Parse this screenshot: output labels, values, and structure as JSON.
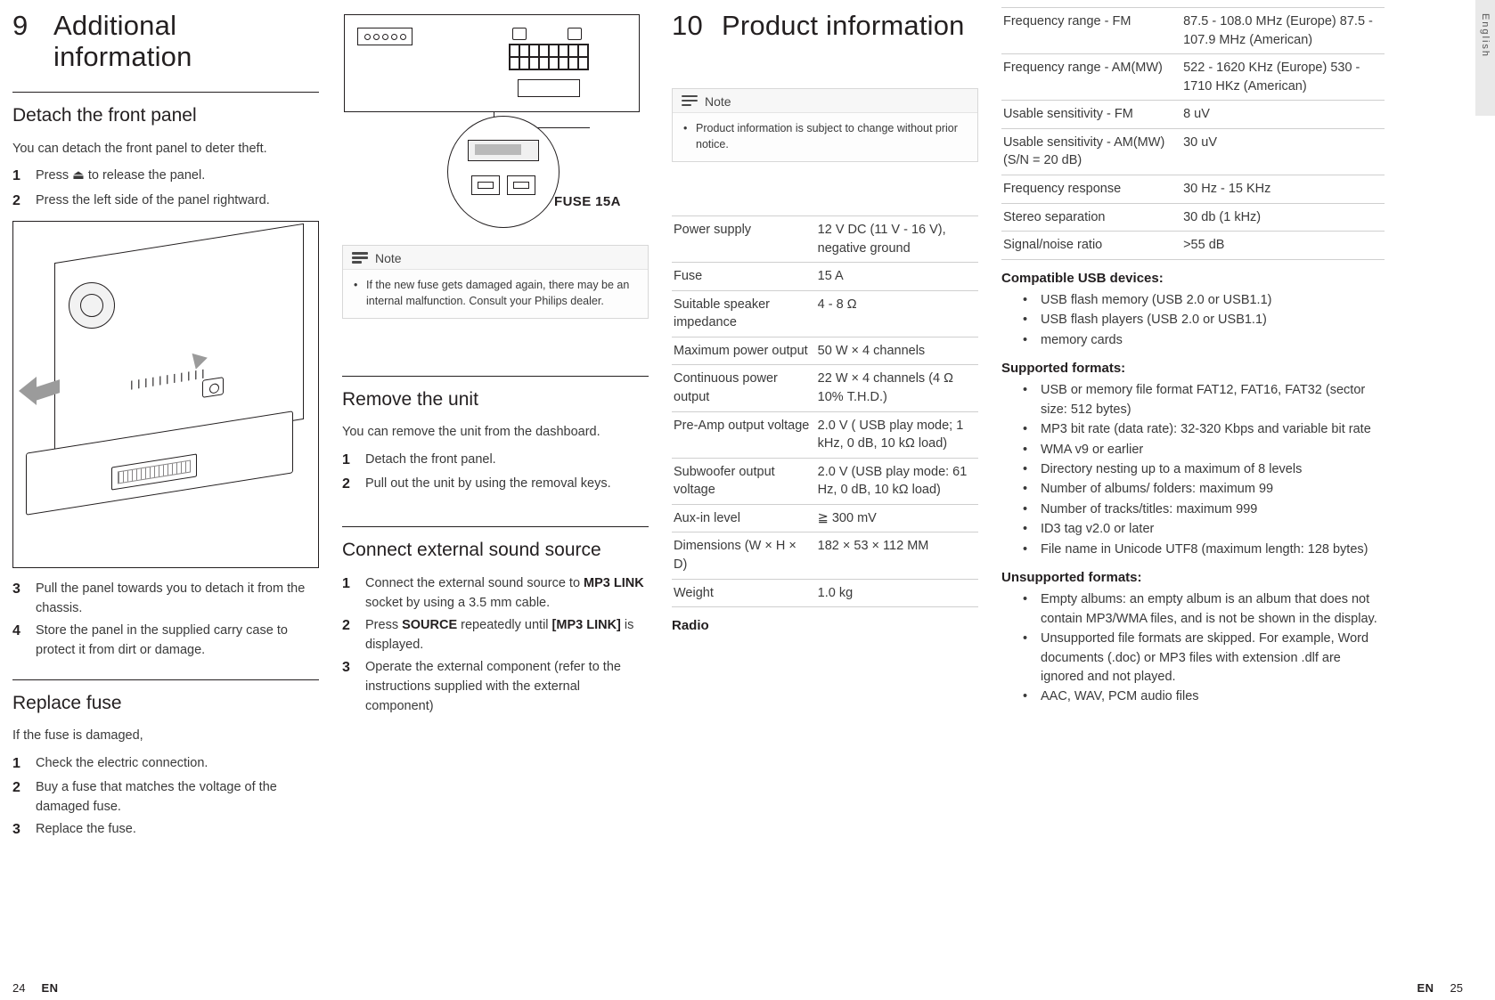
{
  "col1": {
    "chapter_num": "9",
    "chapter_title": "Additional information",
    "section1_title": "Detach the front panel",
    "section1_intro": "You can detach the front panel to deter theft.",
    "section1_steps": [
      {
        "n": "1",
        "text": "Press ⏏ to release the panel."
      },
      {
        "n": "2",
        "text": "Press the left side of the panel rightward."
      }
    ],
    "section1_steps_after": [
      {
        "n": "3",
        "text": "Pull the panel towards you to detach it from the chassis."
      },
      {
        "n": "4",
        "text": "Store the panel in the supplied carry case to protect it from dirt or damage."
      }
    ],
    "section2_title": "Replace fuse",
    "section2_intro": "If the fuse is damaged,",
    "section2_steps": [
      {
        "n": "1",
        "text": "Check the electric connection."
      },
      {
        "n": "2",
        "text": "Buy a fuse that matches the voltage of the damaged fuse."
      },
      {
        "n": "3",
        "text": "Replace the fuse."
      }
    ]
  },
  "col2": {
    "fuse_label": "FUSE 15A",
    "note_label": "Note",
    "note_text": "If the new fuse gets damaged again, there may be an internal malfunction. Consult your Philips dealer.",
    "section1_title": "Remove the unit",
    "section1_intro": "You can remove the unit from the dashboard.",
    "section1_steps": [
      {
        "n": "1",
        "text": "Detach the front panel."
      },
      {
        "n": "2",
        "text": "Pull out the unit by using the removal keys."
      }
    ],
    "section2_title": "Connect external sound source",
    "section2_steps": [
      {
        "n": "1",
        "pre": "Connect the external sound source to ",
        "bold": "MP3 LINK",
        "post": " socket by using a 3.5 mm cable."
      },
      {
        "n": "2",
        "pre": "Press ",
        "bold": "SOURCE",
        "mid": " repeatedly until ",
        "bold2": "[MP3 LINK]",
        "post": " is displayed."
      },
      {
        "n": "3",
        "pre": "Operate the external component (refer to the instructions supplied with the external component)",
        "bold": "",
        "post": ""
      }
    ]
  },
  "col3": {
    "chapter_num": "10",
    "chapter_title": "Product information",
    "note_label": "Note",
    "note_text": "Product information is subject to change without prior notice.",
    "spec_rows": [
      {
        "k": "Power supply",
        "v": "12 V DC (11 V - 16 V), negative ground"
      },
      {
        "k": "Fuse",
        "v": "15 A"
      },
      {
        "k": "Suitable speaker impedance",
        "v": "4 - 8 Ω"
      },
      {
        "k": "Maximum power output",
        "v": "50 W × 4 channels"
      },
      {
        "k": "Continuous power output",
        "v": "22 W × 4 channels (4 Ω 10% T.H.D.)"
      },
      {
        "k": "Pre-Amp output voltage",
        "v": "2.0 V ( USB play mode; 1 kHz, 0 dB, 10 kΩ load)"
      },
      {
        "k": "Subwoofer output voltage",
        "v": "2.0 V (USB play mode: 61 Hz, 0 dB, 10 kΩ load)"
      },
      {
        "k": "Aux-in level",
        "v": "≧ 300 mV"
      },
      {
        "k": "Dimensions (W × H × D)",
        "v": "182 × 53 × 112 MM"
      },
      {
        "k": "Weight",
        "v": "1.0 kg"
      }
    ],
    "radio_heading": "Radio"
  },
  "col4": {
    "spec_rows": [
      {
        "k": "Frequency range - FM",
        "v": "87.5 - 108.0 MHz (Europe) 87.5 - 107.9 MHz (American)"
      },
      {
        "k": "Frequency range - AM(MW)",
        "v": "522 - 1620 KHz (Europe) 530 - 1710 HKz (American)"
      },
      {
        "k": "Usable sensitivity - FM",
        "v": "8 uV"
      },
      {
        "k": "Usable sensitivity - AM(MW) (S/N = 20 dB)",
        "v": "30 uV"
      },
      {
        "k": "Frequency response",
        "v": "30 Hz - 15 KHz"
      },
      {
        "k": "Stereo separation",
        "v": "30 db (1 kHz)"
      },
      {
        "k": "Signal/noise ratio",
        "v": ">55 dB"
      }
    ],
    "compatible_heading": "Compatible USB devices:",
    "compatible_items": [
      "USB flash memory (USB 2.0 or USB1.1)",
      "USB flash players (USB 2.0 or USB1.1)",
      "memory cards"
    ],
    "supported_heading": "Supported formats:",
    "supported_items": [
      "USB or memory file format FAT12, FAT16, FAT32 (sector size: 512 bytes)",
      "MP3 bit rate (data rate): 32-320 Kbps and variable bit rate",
      "WMA v9 or earlier",
      "Directory nesting up to a maximum of 8 levels",
      "Number of albums/ folders: maximum 99",
      "Number of tracks/titles: maximum 999",
      "ID3 tag v2.0 or later",
      "File name in Unicode UTF8 (maximum length: 128 bytes)"
    ],
    "unsupported_heading": "Unsupported formats:",
    "unsupported_items": [
      "Empty albums: an empty album is an album that does not contain MP3/WMA files, and is not be shown in the display.",
      "Unsupported file formats are skipped. For example, Word documents (.doc) or MP3 files with extension .dlf are ignored and not played.",
      "AAC, WAV, PCM audio files"
    ],
    "tab_label": "English"
  },
  "footer": {
    "left_page": "24",
    "left_en": "EN",
    "right_en": "EN",
    "right_page": "25"
  }
}
